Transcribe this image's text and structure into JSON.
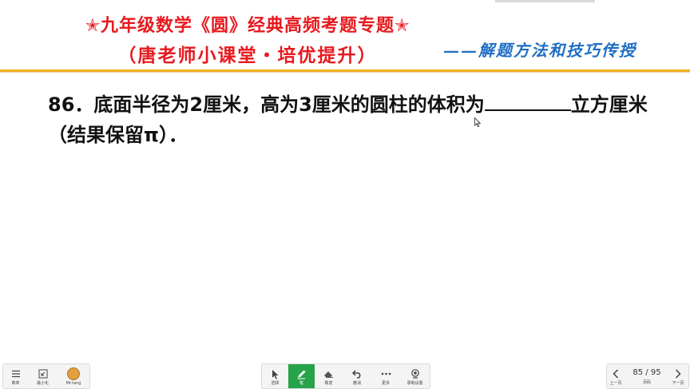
{
  "header": {
    "title_line1": "✭九年级数学《圆》经典高频考题专题✭",
    "title_line2": "（唐老师小课堂・培优提升）",
    "subtitle": "——解题方法和技巧传授",
    "colors": {
      "title": "#e8191e",
      "subtitle": "#1f6fc4",
      "rule": "#f0b020"
    }
  },
  "question": {
    "part1": "86．底面半径为2厘米，高为3厘米的圆柱的体积为",
    "part2": "立方厘米（结果保留π）．"
  },
  "toolbar_left": {
    "items": [
      {
        "icon": "menu-icon",
        "label": "菜单"
      },
      {
        "icon": "minimize-icon",
        "label": "最小化"
      },
      {
        "icon": "avatar-icon",
        "label": "Mr.tang"
      }
    ]
  },
  "toolbar_center": {
    "items": [
      {
        "icon": "select-cursor-icon",
        "label": "选择"
      },
      {
        "icon": "pen-icon",
        "label": "笔",
        "active": true
      },
      {
        "icon": "eraser-icon",
        "label": "橡皮"
      },
      {
        "icon": "undo-icon",
        "label": "撤消"
      },
      {
        "icon": "more-icon",
        "label": "更多"
      },
      {
        "icon": "record-icon",
        "label": "录制设置"
      }
    ],
    "active_color": "#27a34a"
  },
  "toolbar_right": {
    "prev_label": "上一页",
    "page_indicator": "85 / 95",
    "page_label": "页码",
    "next_label": "下一页"
  }
}
